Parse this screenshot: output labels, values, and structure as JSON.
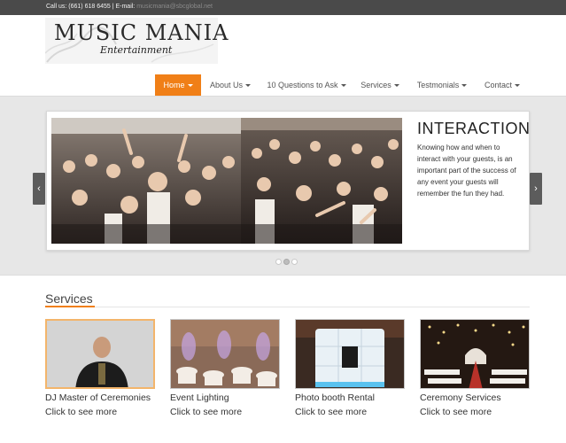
{
  "topbar": {
    "phone": "Call us: (661) 618 6455 | E-mail:",
    "email": "musicmania@sbcglobal.net"
  },
  "logo": {
    "title": "MUSIC MANIA",
    "subtitle": "Entertainment"
  },
  "nav": {
    "items": [
      {
        "label": "Home",
        "active": true
      },
      {
        "label": "About Us"
      },
      {
        "label": "10 Questions to Ask"
      },
      {
        "label": "Services"
      },
      {
        "label": "Testmonials"
      },
      {
        "label": "Contact"
      }
    ]
  },
  "slider": {
    "heading": "INTERACTION",
    "text": "Knowing how and when to interact with your guests, is an important part of the success of any event your guests will remember the fun they had.",
    "prev_icon": "‹",
    "next_icon": "›",
    "dot_count": 3,
    "active_dot": 2
  },
  "services": {
    "heading": "Services",
    "cards": [
      {
        "title": "DJ Master of Ceremonies",
        "link": "Click to see more"
      },
      {
        "title": "Event Lighting",
        "link": "Click to see more"
      },
      {
        "title": "Photo booth Rental",
        "link": "Click to see more"
      },
      {
        "title": "Ceremony Services",
        "link": "Click to see more"
      }
    ]
  },
  "colors": {
    "accent": "#f07f17",
    "topbar": "#4a4a4a",
    "slider_band": "#e7e7e7"
  }
}
